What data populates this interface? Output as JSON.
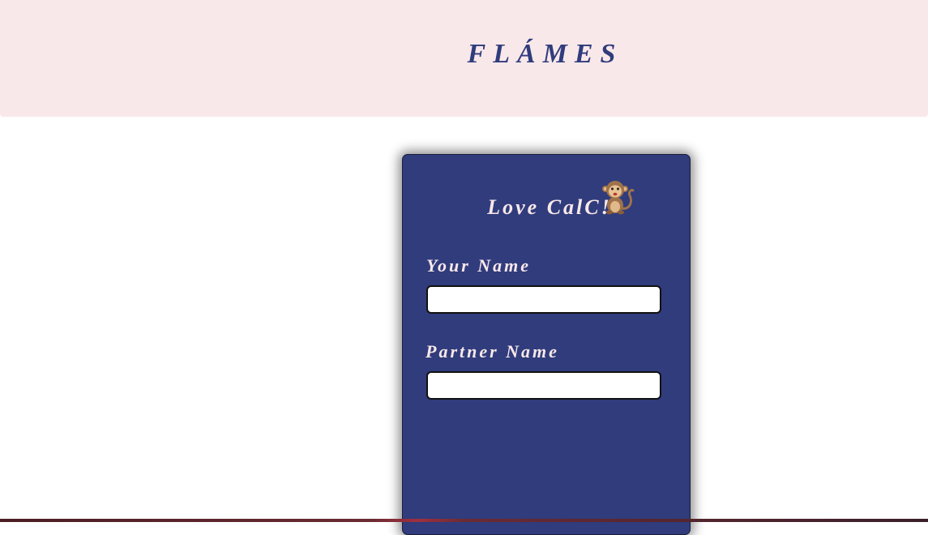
{
  "header": {
    "title": "FLÁMES"
  },
  "card": {
    "title": "Love CalC!",
    "title_icon": "monkey-icon",
    "your_name": {
      "label": "Your Name",
      "value": "",
      "placeholder": ""
    },
    "partner_name": {
      "label": "Partner Name",
      "value": "",
      "placeholder": ""
    }
  },
  "colors": {
    "header_bg": "#f9e8ea",
    "card_bg": "#303c7c",
    "accent_text": "#303c7c",
    "card_text": "#f9e8ea"
  }
}
